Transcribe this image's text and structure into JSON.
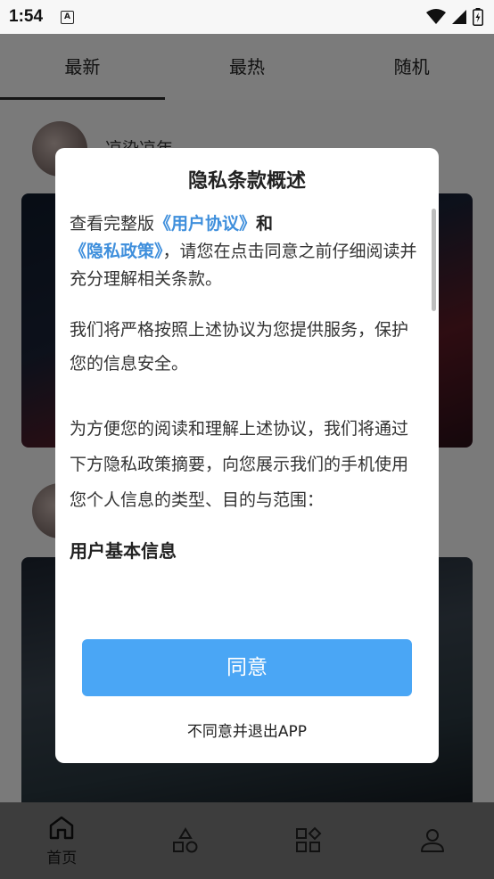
{
  "status_bar": {
    "time": "1:54",
    "notification_icon": "A"
  },
  "tabs": [
    {
      "label": "最新",
      "active": true
    },
    {
      "label": "最热",
      "active": false
    },
    {
      "label": "随机",
      "active": false
    }
  ],
  "feed": {
    "author1": "凉染凉年"
  },
  "dialog": {
    "title": "隐私条款概述",
    "p1_prefix": "查看完整版",
    "user_agreement": "《用户协议》",
    "and": "和",
    "privacy_policy": "《隐私政策》",
    "p1_suffix": "，请您在点击同意之前仔细阅读并充分理解相关条款。",
    "p2": "我们将严格按照上述协议为您提供服务，保护您的信息安全。",
    "p3": "为方便您的阅读和理解上述协议，我们将通过下方隐私政策摘要，向您展示我们的手机使用您个人信息的类型、目的与范围：",
    "section_heading": "用户基本信息",
    "agree_button": "同意",
    "disagree_link": "不同意并退出APP"
  },
  "bottom_nav": [
    {
      "label": "首页",
      "icon": "home-icon"
    },
    {
      "label": "",
      "icon": "shapes-icon"
    },
    {
      "label": "",
      "icon": "apps-icon"
    },
    {
      "label": "",
      "icon": "person-icon"
    }
  ],
  "colors": {
    "link": "#3f8fdc",
    "primary_button": "#4aa6f5"
  }
}
